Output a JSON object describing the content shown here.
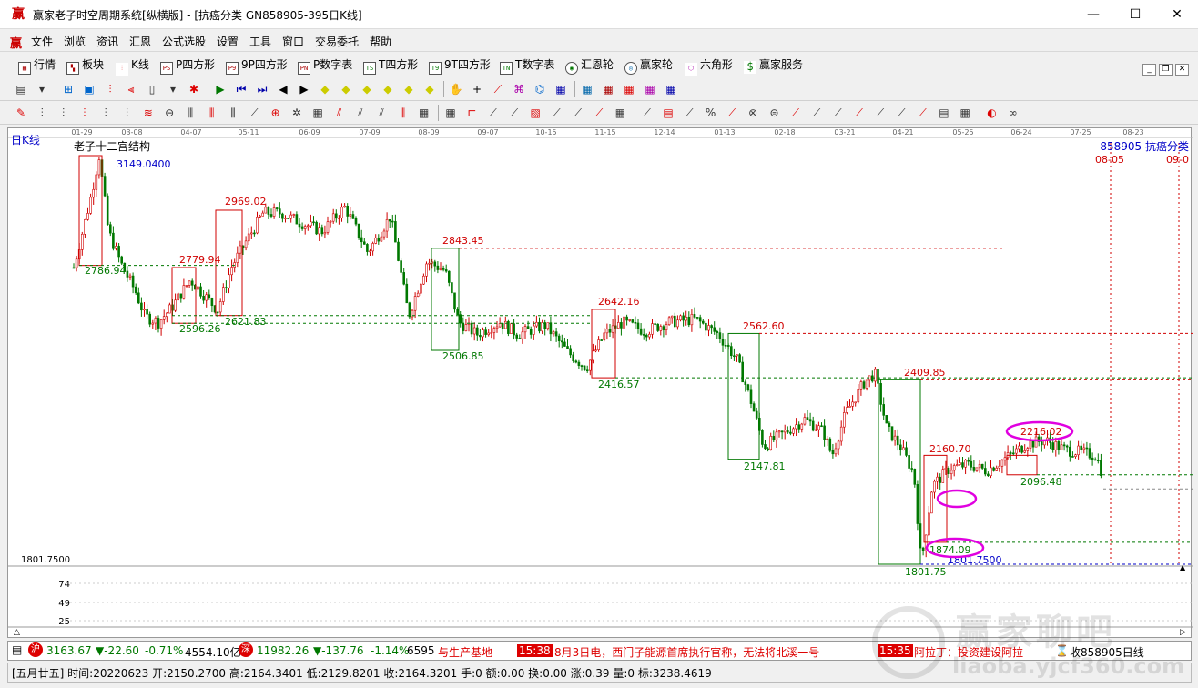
{
  "window": {
    "title": "赢家老子时空周期系统[纵横版] - [抗癌分类  GN858905-395日K线]",
    "minimize": "—",
    "maximize": "☐",
    "close": "✕"
  },
  "menu": [
    "文件",
    "浏览",
    "资讯",
    "汇恩",
    "公式选股",
    "设置",
    "工具",
    "窗口",
    "交易委托",
    "帮助"
  ],
  "nav": [
    {
      "label": "行情",
      "icon": "grid-icon"
    },
    {
      "label": "板块",
      "icon": "blocks-icon"
    },
    {
      "label": "K线",
      "icon": "kline-icon"
    },
    {
      "label": "P四方形",
      "icon": "ps-icon",
      "badge": "PS"
    },
    {
      "label": "9P四方形",
      "icon": "p9-icon",
      "badge": "P9"
    },
    {
      "label": "P数字表",
      "icon": "pn-icon",
      "badge": "PN"
    },
    {
      "label": "T四方形",
      "icon": "ts-icon",
      "badge": "TS"
    },
    {
      "label": "9T四方形",
      "icon": "t9-icon",
      "badge": "T9"
    },
    {
      "label": "T数字表",
      "icon": "tn-icon",
      "badge": "TN"
    },
    {
      "label": "汇恩轮",
      "icon": "wheel-icon"
    },
    {
      "label": "赢家轮",
      "icon": "winner-wheel-icon"
    },
    {
      "label": "六角形",
      "icon": "hexagon-icon"
    },
    {
      "label": "赢家服务",
      "icon": "dollar-icon"
    }
  ],
  "chart": {
    "stock_label": "日K线",
    "struct_label": "老子十二宫结构",
    "code_label": "858905 抗癌分类",
    "y_label_low": "1801.7500",
    "vol_labels": [
      "74",
      "49",
      "25"
    ],
    "dates": [
      "01-29",
      "03-08",
      "04-07",
      "05-11",
      "06-09",
      "07-09",
      "08-09",
      "09-07",
      "10-15",
      "11-15",
      "12-14",
      "01-13",
      "02-18",
      "03-21",
      "04-21",
      "05-25",
      "06-24",
      "07-25",
      "08-23"
    ],
    "future_dates": [
      "08-05",
      "09-0"
    ],
    "levels": [
      {
        "text": "3149.0400",
        "color": "#0000c8"
      },
      {
        "text": "2786.94",
        "color": "#007800"
      },
      {
        "text": "2779.94",
        "color": "#d00000"
      },
      {
        "text": "2969.02",
        "color": "#d00000"
      },
      {
        "text": "2596.26",
        "color": "#007800"
      },
      {
        "text": "2621.83",
        "color": "#007800"
      },
      {
        "text": "2843.45",
        "color": "#d00000"
      },
      {
        "text": "2506.85",
        "color": "#007800"
      },
      {
        "text": "2642.16",
        "color": "#d00000"
      },
      {
        "text": "2416.57",
        "color": "#007800"
      },
      {
        "text": "2562.60",
        "color": "#d00000"
      },
      {
        "text": "2147.81",
        "color": "#007800"
      },
      {
        "text": "2409.85",
        "color": "#d00000"
      },
      {
        "text": "2160.70",
        "color": "#d00000"
      },
      {
        "text": "2216.02",
        "color": "#d00000"
      },
      {
        "text": "2096.48",
        "color": "#007800"
      },
      {
        "text": "1874.09",
        "color": "#007800"
      },
      {
        "text": "1801.7500",
        "color": "#0000c8"
      },
      {
        "text": "1801.75",
        "color": "#007800"
      }
    ]
  },
  "ticker": {
    "sh_value": "3163.67",
    "sh_change": "▼-22.60",
    "sh_pct": "-0.71%",
    "sh_amount": "4554.10亿",
    "sz_value": "11982.26",
    "sz_change": "▼-137.76",
    "sz_pct": "-1.14%",
    "sz_amount": "6595.5",
    "news1": "与生产基地",
    "time1": "15:38",
    "news2": "8月3日电，西门子能源首席执行官称，无法将北溪一号",
    "time2": "15:35",
    "news3": "阿拉丁：投资建设阿拉",
    "right_label": "收858905日线"
  },
  "status": {
    "text": "[五月廿五] 时间:20220623 开:2150.2700 高:2164.3401 低:2129.8201 收:2164.3201 手:0 额:0.00 换:0.00 涨:0.39 量:0 标:3238.4619"
  },
  "watermark": {
    "line1": "赢家聊吧",
    "line2": "liaoba.yjcf360.com"
  },
  "colors": {
    "up": "#d00000",
    "down": "#007800",
    "highlight": "#e000e0"
  }
}
